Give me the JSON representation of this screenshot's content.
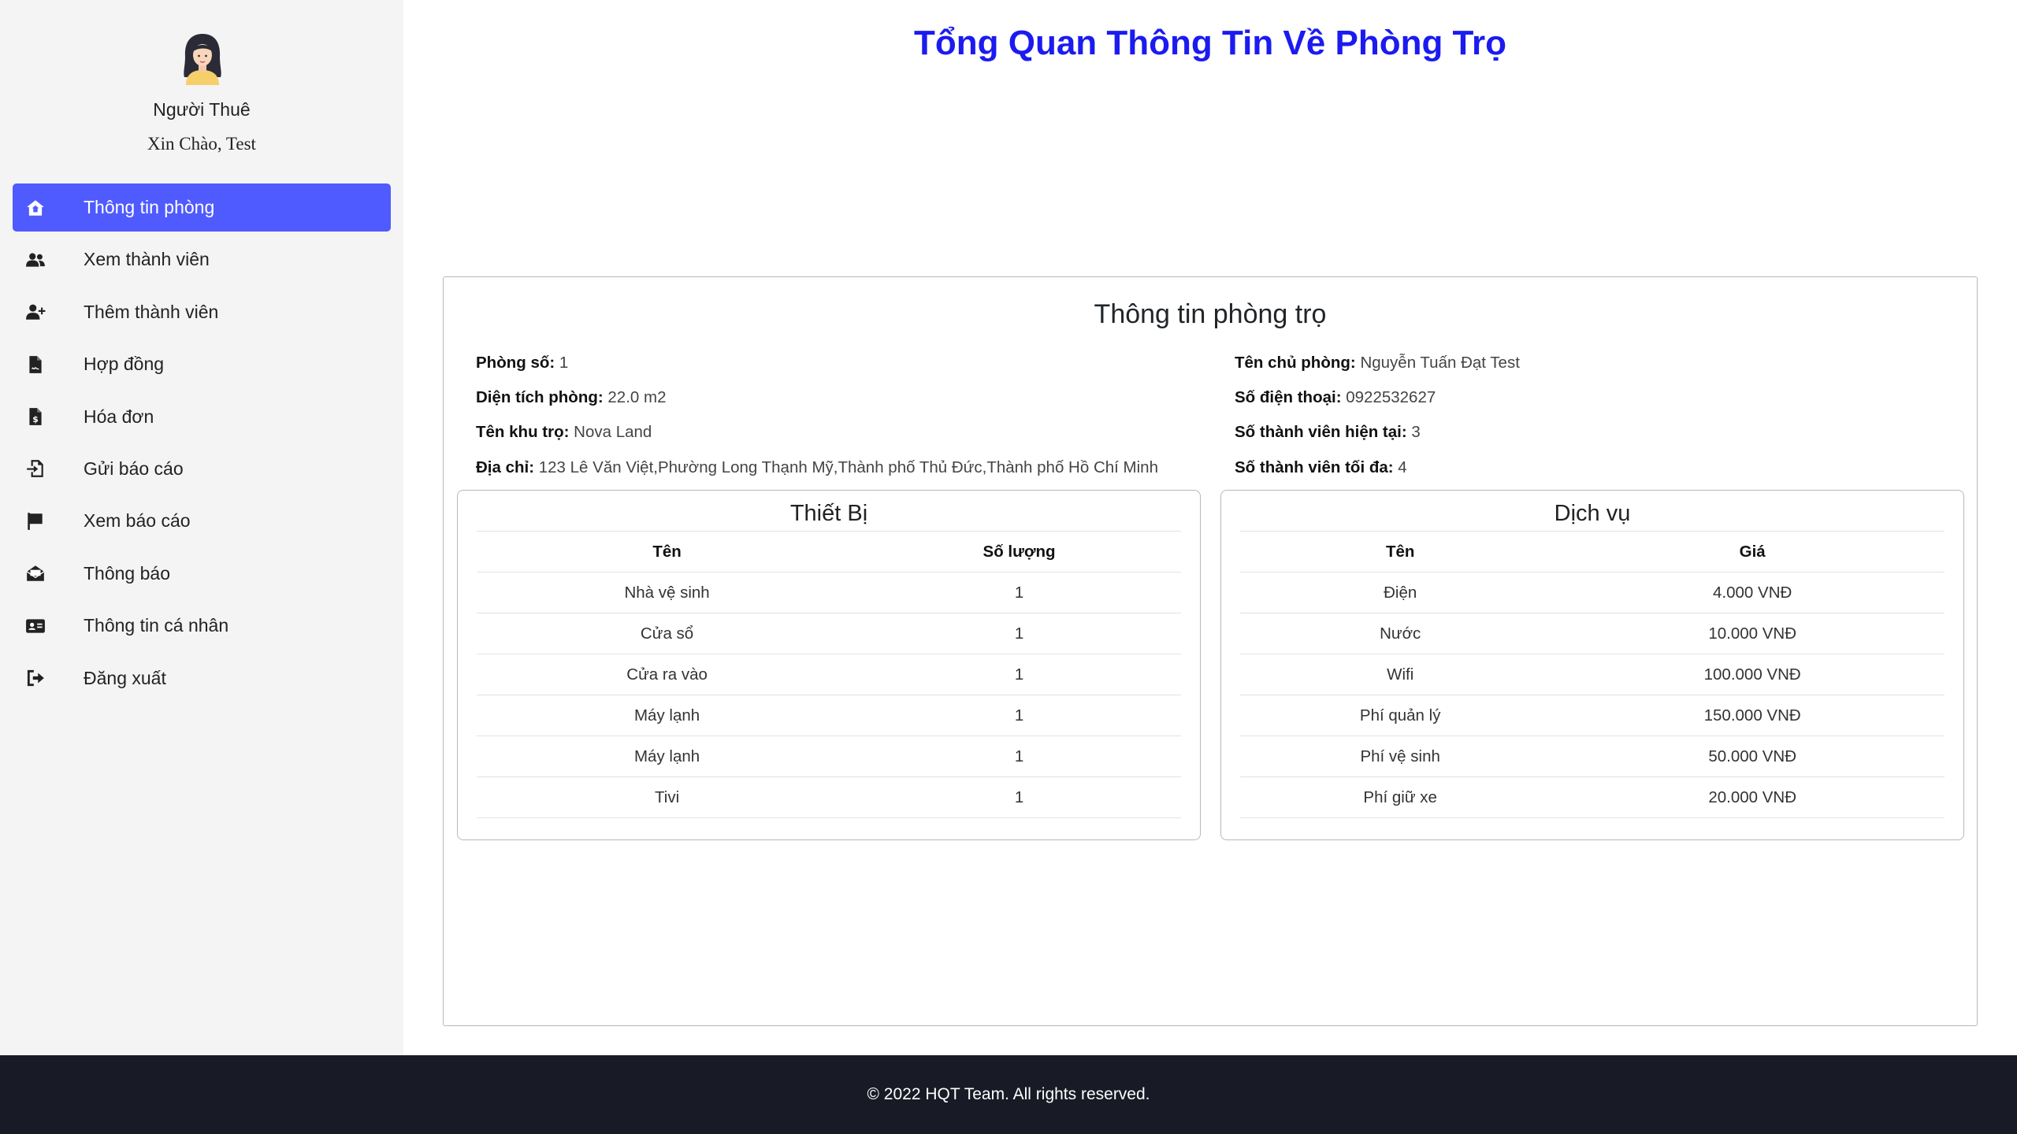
{
  "sidebar": {
    "role": "Người Thuê",
    "greeting": "Xin Chào, Test",
    "items": [
      {
        "label": "Thông tin phòng",
        "icon": "home-icon"
      },
      {
        "label": "Xem thành viên",
        "icon": "users-icon"
      },
      {
        "label": "Thêm thành viên",
        "icon": "user-plus-icon"
      },
      {
        "label": "Hợp đồng",
        "icon": "file-contract-icon"
      },
      {
        "label": "Hóa đơn",
        "icon": "invoice-icon"
      },
      {
        "label": "Gửi báo cáo",
        "icon": "send-report-icon"
      },
      {
        "label": "Xem báo cáo",
        "icon": "flag-icon"
      },
      {
        "label": "Thông báo",
        "icon": "envelope-open-icon"
      },
      {
        "label": "Thông tin cá nhân",
        "icon": "id-card-icon"
      },
      {
        "label": "Đăng xuất",
        "icon": "sign-out-icon"
      }
    ]
  },
  "header": {
    "title": "Tổng Quan Thông Tin Về Phòng Trọ"
  },
  "room": {
    "title": "Thông tin phòng trọ",
    "left": [
      {
        "label": "Phòng số:",
        "value": "1"
      },
      {
        "label": "Diện tích phòng:",
        "value": "22.0 m2"
      },
      {
        "label": "Tên khu trọ:",
        "value": "Nova Land"
      },
      {
        "label": "Địa chỉ:",
        "value": "123 Lê Văn Việt,Phường Long Thạnh Mỹ,Thành phố Thủ Đức,Thành phố Hồ Chí Minh"
      }
    ],
    "right": [
      {
        "label": "Tên chủ phòng:",
        "value": "Nguyễn Tuấn Đạt Test"
      },
      {
        "label": "Số điện thoại:",
        "value": "0922532627"
      },
      {
        "label": "Số thành viên hiện tại:",
        "value": "3"
      },
      {
        "label": "Số thành viên tối đa:",
        "value": "4"
      }
    ]
  },
  "equipment": {
    "title": "Thiết Bị",
    "columns": [
      "Tên",
      "Số lượng"
    ],
    "rows": [
      [
        "Nhà vệ sinh",
        "1"
      ],
      [
        "Cửa sổ",
        "1"
      ],
      [
        "Cửa ra vào",
        "1"
      ],
      [
        "Máy lạnh",
        "1"
      ],
      [
        "Máy lạnh",
        "1"
      ],
      [
        "Tivi",
        "1"
      ]
    ]
  },
  "services": {
    "title": "Dịch vụ",
    "columns": [
      "Tên",
      "Giá"
    ],
    "rows": [
      [
        "Điện",
        "4.000 VNĐ"
      ],
      [
        "Nước",
        "10.000 VNĐ"
      ],
      [
        "Wifi",
        "100.000 VNĐ"
      ],
      [
        "Phí quản lý",
        "150.000 VNĐ"
      ],
      [
        "Phí vệ sinh",
        "50.000 VNĐ"
      ],
      [
        "Phí giữ xe",
        "20.000 VNĐ"
      ]
    ]
  },
  "footer": {
    "text": "© 2022 HQT Team. All rights reserved."
  },
  "colors": {
    "accent": "#4f5bff",
    "title": "#1b1bf0",
    "footer_bg": "#181a26",
    "sidebar_bg": "#f4f4f5"
  }
}
